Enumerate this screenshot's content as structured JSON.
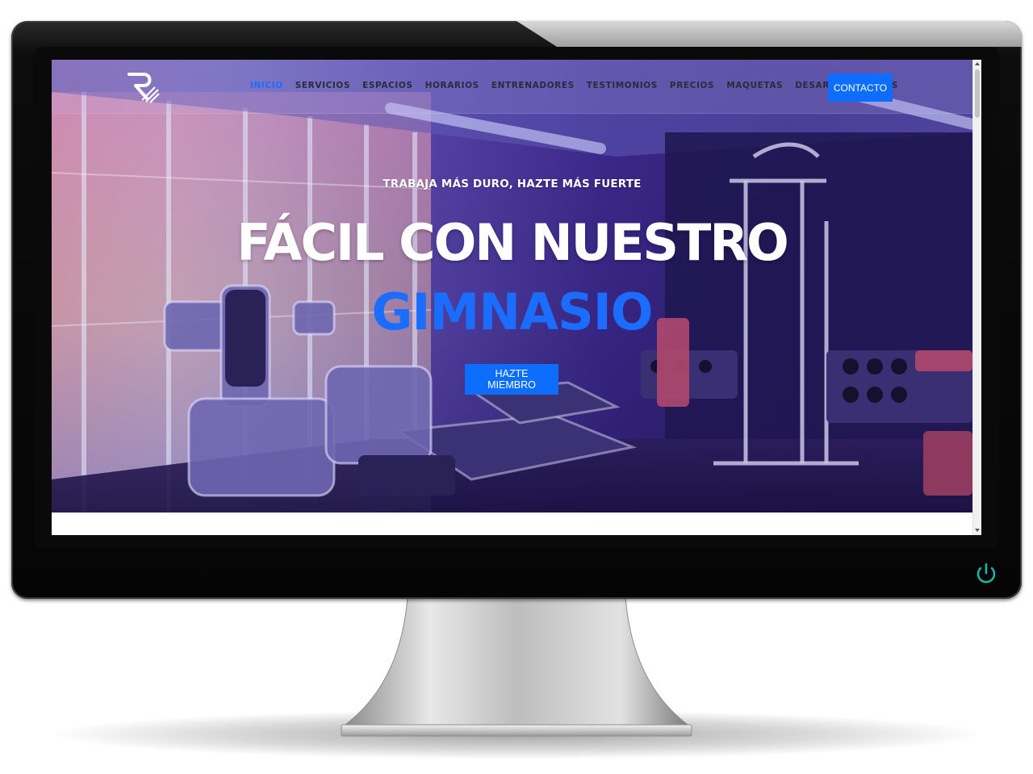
{
  "site": {
    "nav": {
      "items": [
        {
          "label": "INICIO",
          "active": true
        },
        {
          "label": "SERVICIOS",
          "active": false
        },
        {
          "label": "ESPACIOS",
          "active": false
        },
        {
          "label": "HORARIOS",
          "active": false
        },
        {
          "label": "ENTRENADORES",
          "active": false
        },
        {
          "label": "TESTIMONIOS",
          "active": false
        },
        {
          "label": "PRECIOS",
          "active": false
        },
        {
          "label": "MAQUETAS",
          "active": false
        },
        {
          "label": "DESARROLLADORES",
          "active": false
        }
      ],
      "contact_label": "CONTACTO"
    },
    "hero": {
      "tagline": "TRABAJA MÁS DURO, HAZTE MÁS FUERTE",
      "headline": "FÁCIL CON NUESTRO",
      "headline_accent": "GIMNASIO",
      "cta_label": "HAZTE MIEMBRO"
    }
  },
  "icons": {
    "logo": "brand-logo-icon",
    "power": "power-icon"
  },
  "colors": {
    "accent": "#0d6efd",
    "active_nav": "#1c6cff",
    "power_led": "#1bb6a8"
  }
}
